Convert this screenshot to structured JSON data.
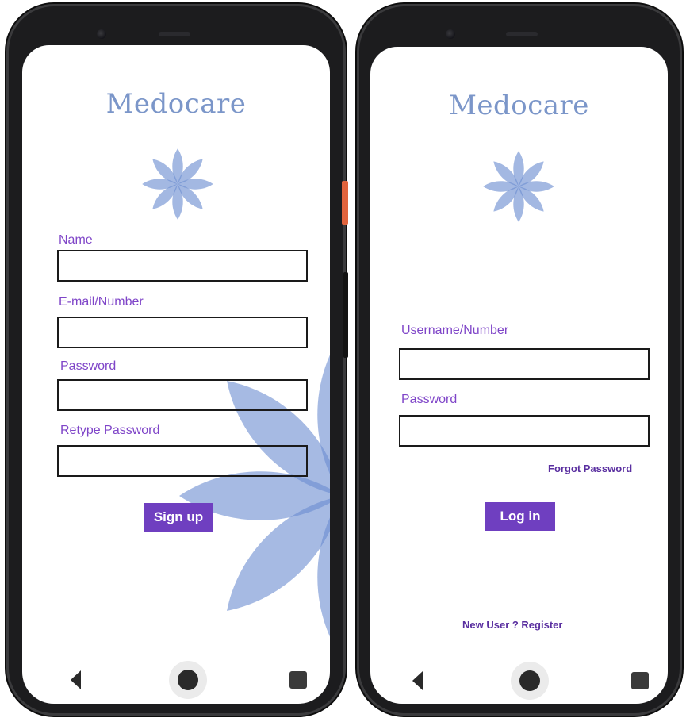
{
  "signup_screen": {
    "brand": "Medocare",
    "fields": [
      {
        "label": "Name",
        "value": "",
        "placeholder": ""
      },
      {
        "label": "E-mail/Number",
        "value": "",
        "placeholder": ""
      },
      {
        "label": "Password",
        "value": "",
        "placeholder": ""
      },
      {
        "label": "Retype Password",
        "value": "",
        "placeholder": ""
      }
    ],
    "submit_label": "Sign up"
  },
  "login_screen": {
    "brand": "Medocare",
    "fields": [
      {
        "label": "Username/Number",
        "value": "",
        "placeholder": ""
      },
      {
        "label": "Password",
        "value": "",
        "placeholder": ""
      }
    ],
    "forgot_link": "Forgot Password",
    "submit_label": "Log in",
    "register_link": "New User ? Register"
  },
  "icons": {
    "logo": "lotus-flower-icon",
    "nav_back": "back-triangle-icon",
    "nav_home": "home-circle-icon",
    "nav_recents": "recents-square-icon"
  },
  "colors": {
    "brand_text": "#7b96c9",
    "accent": "#6f3fc0",
    "label": "#7f45c8",
    "link": "#5a2fa0",
    "flower_petal": "#6b8cd0",
    "phone_frame": "#1c1c1e"
  }
}
